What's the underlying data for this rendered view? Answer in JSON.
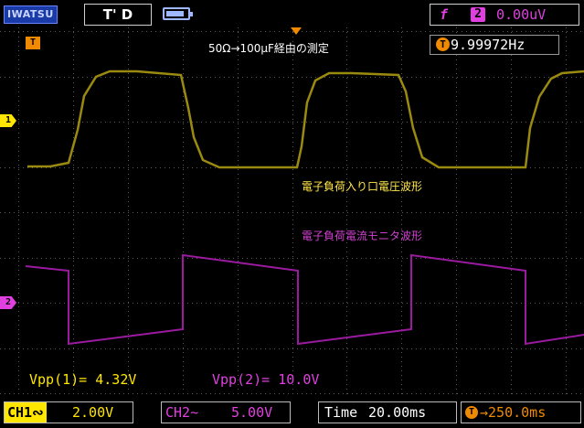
{
  "topbar": {
    "brand": "IWATSU",
    "trigger_state": "T' D",
    "battery_level": 0.8,
    "trigger_edge_symbol": "f",
    "trigger_source": "2",
    "trigger_level": "0.00uV"
  },
  "screen": {
    "title_note": "50Ω→100μF経由の測定",
    "frequency": "9.99972Hz",
    "frequency_icon": "T",
    "ch1_marker": "1",
    "ch2_marker": "2",
    "trigger_marker": "T",
    "ch1_wave_label": "電子負荷入り口電圧波形",
    "ch2_wave_label": "電子負荷電流モニタ波形",
    "vpp1": "Vpp(1)= 4.32V",
    "vpp2": "Vpp(2)= 10.0V"
  },
  "bottombar": {
    "ch1_tag": "CH1∾",
    "ch1_scale": "2.00V",
    "ch2_tag": "CH2∼",
    "ch2_scale": "5.00V",
    "timebase_label": "Time",
    "timebase_value": "20.00ms",
    "position_icon": "T",
    "position_value": "→250.0ms"
  },
  "colors": {
    "ch1": "#ffe600",
    "ch1_trace": "#9a8a10",
    "ch2": "#e040e0",
    "ch2_trace": "#9a1aa0",
    "trigger": "#f08a00",
    "grid": "#5a5a5a"
  }
}
